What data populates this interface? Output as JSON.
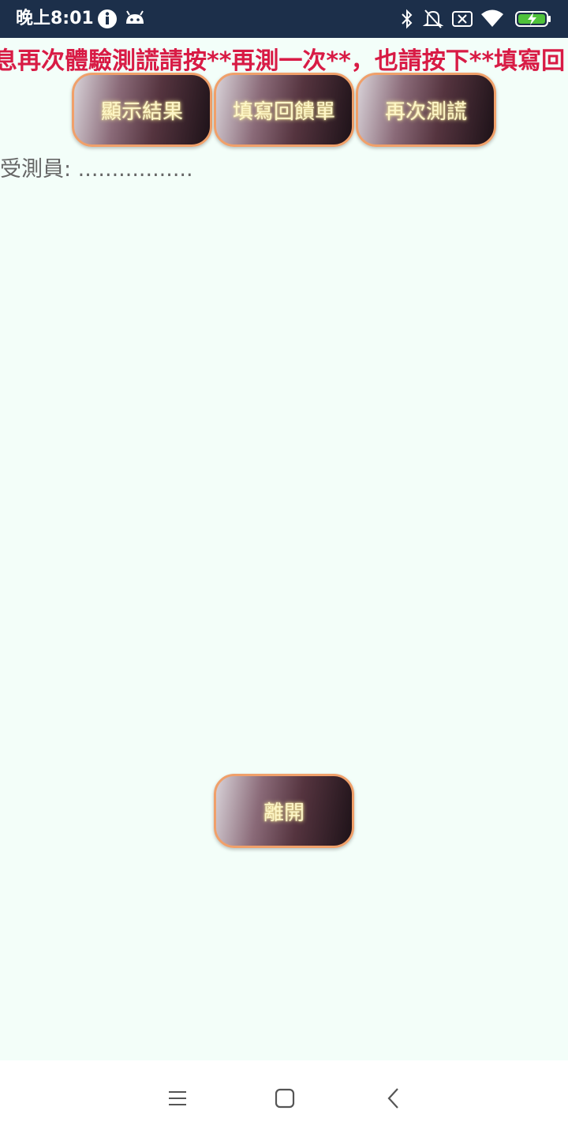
{
  "status_bar": {
    "time": "晚上8:01",
    "left_icons": [
      "info-icon",
      "android-icon"
    ],
    "right_icons": [
      "bluetooth-icon",
      "notifications-off-icon",
      "sim-x-icon",
      "wifi-icon",
      "battery-charging-icon"
    ]
  },
  "marquee_text": "息再次體驗測謊請按**再測一次**，也請按下**填寫回",
  "buttons": {
    "show_result": "顯示結果",
    "feedback": "填寫回饋單",
    "retest": "再次測謊",
    "leave": "離開"
  },
  "tester_label": "受測員: .................",
  "nav_bar": {
    "icons": [
      "menu-icon",
      "home-square-icon",
      "back-chevron-icon"
    ]
  },
  "colors": {
    "status_bar_bg": "#1c2f4a",
    "content_bg": "#f3fef9",
    "marquee_text": "#d81b45",
    "button_border": "#f0a06a",
    "button_text": "#fdf6c8"
  }
}
